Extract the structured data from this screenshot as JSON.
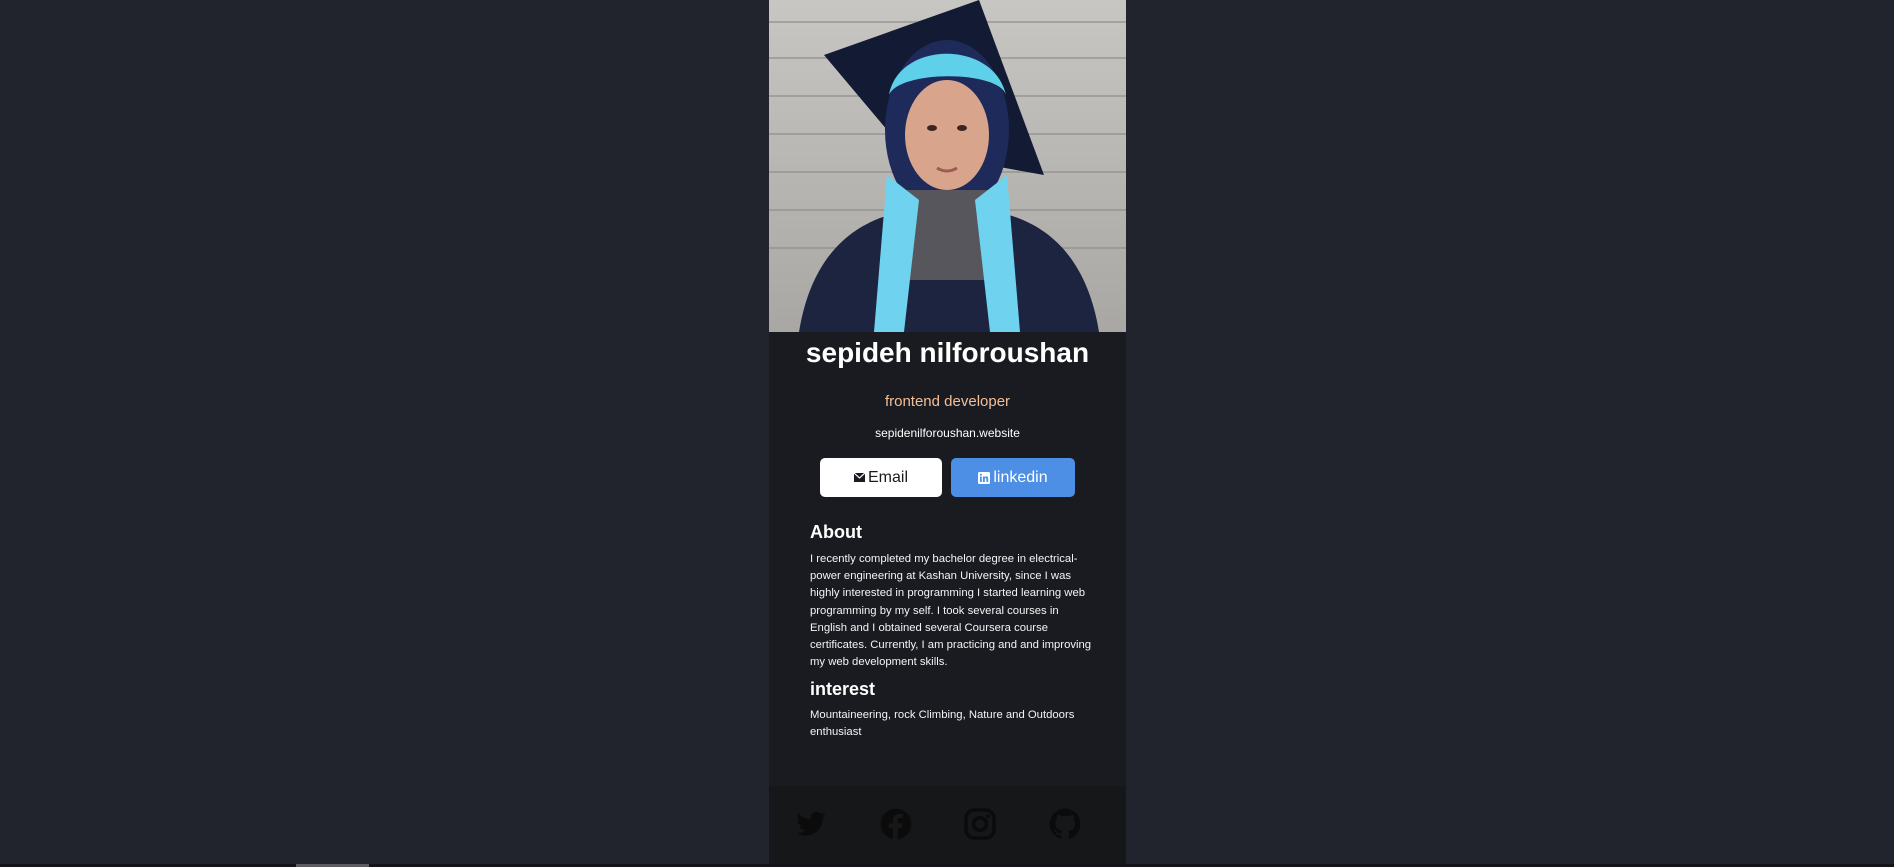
{
  "profile": {
    "name": "sepideh nilforoushan",
    "role": "frontend developer",
    "website": "sepidenilforoushan.website",
    "photo_icon": "profile-photo"
  },
  "buttons": {
    "email_label": "Email",
    "email_icon": "envelope-icon",
    "linkedin_label": "linkedin",
    "linkedin_icon": "linkedin-icon"
  },
  "about": {
    "title": "About",
    "text": "I recently completed my bachelor degree in electrical-power engineering at Kashan University, since I was highly interested in programming I started learning web programming by my self. I took several courses in English and I obtained several Coursera course certificates. Currently, I am practicing and and improving my web development skills."
  },
  "interest": {
    "title": "interest",
    "text": "Mountaineering, rock Climbing, Nature and Outdoors enthusiast"
  },
  "footer": {
    "icons": [
      "twitter-icon",
      "facebook-icon",
      "instagram-icon",
      "github-icon"
    ]
  },
  "colors": {
    "background": "#22242d",
    "card": "#1a1b20",
    "footer": "#161719",
    "role_accent": "#f3bf99",
    "linkedin_button": "#4c8fe5",
    "email_button": "#ffffff",
    "social_icon": "#0b0b0c"
  }
}
